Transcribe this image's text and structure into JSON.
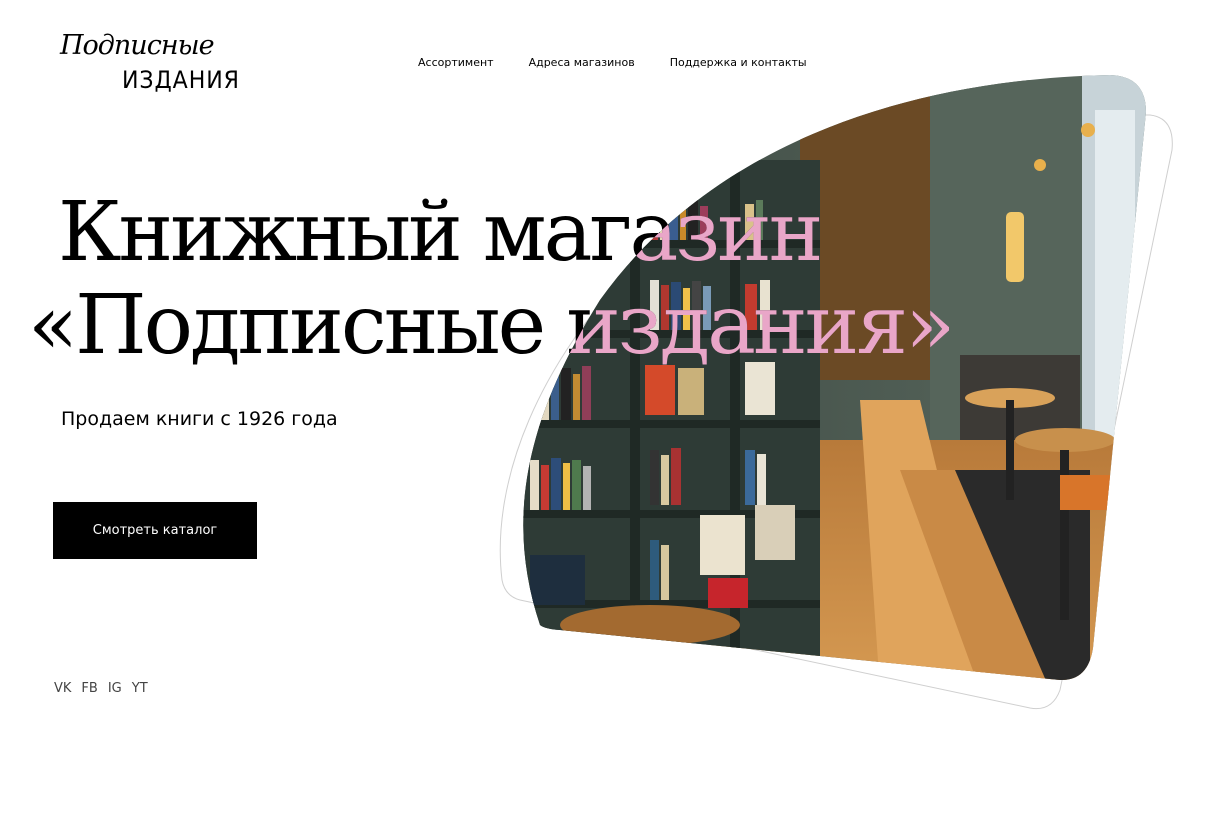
{
  "brand": {
    "logo_script": "Подписные",
    "logo_caps": "ИЗДАНИЯ"
  },
  "nav": {
    "items": [
      {
        "label": "Ассортимент"
      },
      {
        "label": "Адреса магазинов"
      },
      {
        "label": "Поддержка и контакты"
      }
    ]
  },
  "hero": {
    "title_line1": "Книжный магазин",
    "title_line2": "«Подписные издания»",
    "subtitle": "Продаем книги с 1926 года",
    "cta_label": "Смотреть каталог",
    "image_alt": "bookstore-interior-photo"
  },
  "social": {
    "links": [
      {
        "label": "VK"
      },
      {
        "label": "FB"
      },
      {
        "label": "IG"
      },
      {
        "label": "YT"
      }
    ]
  },
  "colors": {
    "accent_pink": "#e9a6c8",
    "cta_bg": "#000000",
    "wood": "#c9883e",
    "shelf": "#2f3d37",
    "wall": "#4a5a50"
  }
}
